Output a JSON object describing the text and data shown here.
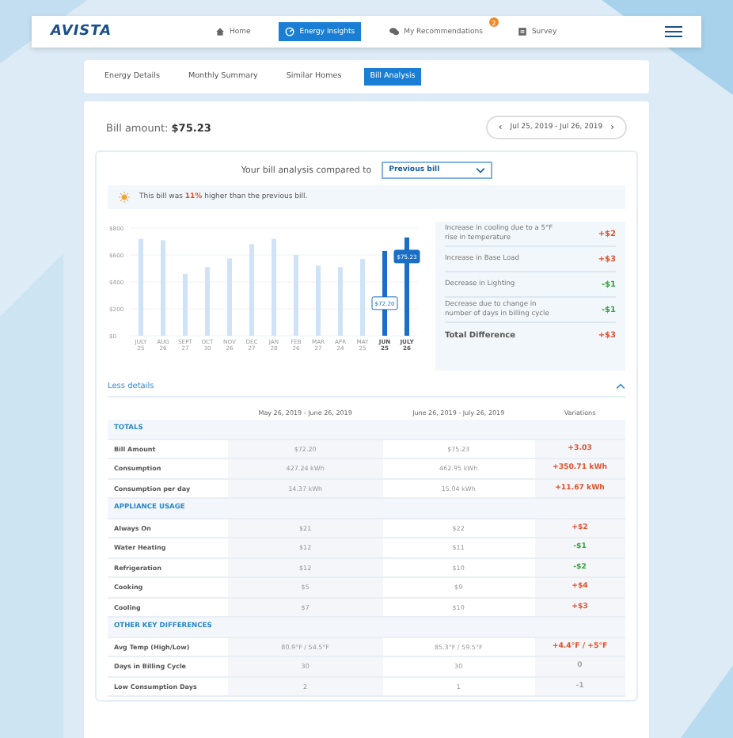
{
  "nav": {
    "logo": "AVISTA",
    "items": [
      {
        "label": "Home",
        "selected": false
      },
      {
        "label": "Energy Insights",
        "selected": true
      },
      {
        "label": "My Recommendations",
        "selected": false,
        "badge": "2"
      },
      {
        "label": "Survey",
        "selected": false
      }
    ]
  },
  "tabs": [
    {
      "label": "Energy Details",
      "selected": false
    },
    {
      "label": "Monthly Summary",
      "selected": false
    },
    {
      "label": "Similar Homes",
      "selected": false
    },
    {
      "label": "Bill Analysis",
      "selected": true
    }
  ],
  "bill": {
    "label": "Bill amount:",
    "amount": "$75.23",
    "period": "Jul 25, 2019 - Jul 26, 2019",
    "prev": "‹",
    "next": "›"
  },
  "compare": {
    "label": "Your bill analysis compared to",
    "value": "Previous bill"
  },
  "banner": "This bill was **11%** higher than the previous bill.",
  "chart_data": {
    "type": "bar",
    "categories": [
      "JULY 25",
      "AUG 26",
      "SEPT 27",
      "OCT 30",
      "NOV 26",
      "DEC 27",
      "JAN 28",
      "FEB 26",
      "MAR 27",
      "APR 24",
      "MAY 25",
      "JUN 25",
      "JULY 26"
    ],
    "values": [
      720,
      710,
      460,
      510,
      575,
      680,
      720,
      600,
      520,
      510,
      570,
      630,
      730
    ],
    "ylim": [
      0,
      800
    ],
    "yticks": [
      {
        "value": 0,
        "label": "$0"
      },
      {
        "value": 200,
        "label": "$200"
      },
      {
        "value": 400,
        "label": "$400"
      },
      {
        "value": 600,
        "label": "$600"
      },
      {
        "value": 800,
        "label": "$800"
      }
    ],
    "grid": true,
    "annotations": [
      {
        "x": "JUN 25",
        "text": "$72.20"
      },
      {
        "x": "JULY 26",
        "text": "$75.23"
      }
    ]
  },
  "breakdown": [
    {
      "label": "Increase in cooling due to a 5°F rise in temperature",
      "value": "+$2",
      "color": "#e0522f",
      "kind": "item"
    },
    {
      "label": "Increase in Base Load",
      "value": "+$3",
      "color": "#e0522f",
      "kind": "item"
    },
    {
      "label": "Decrease in Lighting",
      "value": "-$1",
      "color": "#3aa040",
      "kind": "item"
    },
    {
      "label": "Decrease due to change in number of days in billing cycle",
      "value": "-$1",
      "color": "#3aa040",
      "kind": "item"
    },
    {
      "label": "Total Difference",
      "value": "+$3",
      "color": "#e0522f",
      "kind": "total"
    }
  ],
  "details_toggle": {
    "label": "Less details",
    "expanded": true
  },
  "table": {
    "columns": [
      "May 26, 2019 - June 26, 2019",
      "June 26, 2019 - July 26, 2019",
      "Variations"
    ],
    "rows": [
      {
        "kind": "section",
        "label": "TOTALS"
      },
      {
        "kind": "row",
        "label": "Bill Amount",
        "cells": [
          "$72.20",
          "$75.23",
          "+3.03"
        ],
        "color": "#e0522f"
      },
      {
        "kind": "row",
        "label": "Consumption",
        "cells": [
          "427.24 kWh",
          "462.95 kWh",
          "+350.71 kWh"
        ],
        "color": "#e0522f"
      },
      {
        "kind": "row",
        "label": "Consumption per day",
        "cells": [
          "14.37 kWh",
          "15.04 kWh",
          "+11.67 kWh"
        ],
        "color": "#e0522f"
      },
      {
        "kind": "section",
        "label": "APPLIANCE USAGE"
      },
      {
        "kind": "row",
        "label": "Always On",
        "cells": [
          "$21",
          "$22",
          "+$2"
        ],
        "color": "#e0522f"
      },
      {
        "kind": "row",
        "label": "Water Heating",
        "cells": [
          "$12",
          "$11",
          "-$1"
        ],
        "color": "#3aa040"
      },
      {
        "kind": "row",
        "label": "Refrigeration",
        "cells": [
          "$12",
          "$10",
          "-$2"
        ],
        "color": "#3aa040"
      },
      {
        "kind": "row",
        "label": "Cooking",
        "cells": [
          "$5",
          "$9",
          "+$4"
        ],
        "color": "#e0522f"
      },
      {
        "kind": "row",
        "label": "Cooling",
        "cells": [
          "$7",
          "$10",
          "+$3"
        ],
        "color": "#e0522f"
      },
      {
        "kind": "section",
        "label": "OTHER KEY DIFFERENCES"
      },
      {
        "kind": "row",
        "label": "Avg Temp (High/Low)",
        "cells": [
          "80.9°F / 54.5°F",
          "85.3°F / 59.5°F",
          "+4.4°F / +5°F"
        ],
        "color": "#e0522f"
      },
      {
        "kind": "row",
        "label": "Days in Billing Cycle",
        "cells": [
          "30",
          "30",
          "0"
        ],
        "color": "#aaaaaa"
      },
      {
        "kind": "row",
        "label": "Low Consumption Days",
        "cells": [
          "2",
          "1",
          "-1"
        ],
        "color": "#aaaaaa"
      }
    ]
  }
}
